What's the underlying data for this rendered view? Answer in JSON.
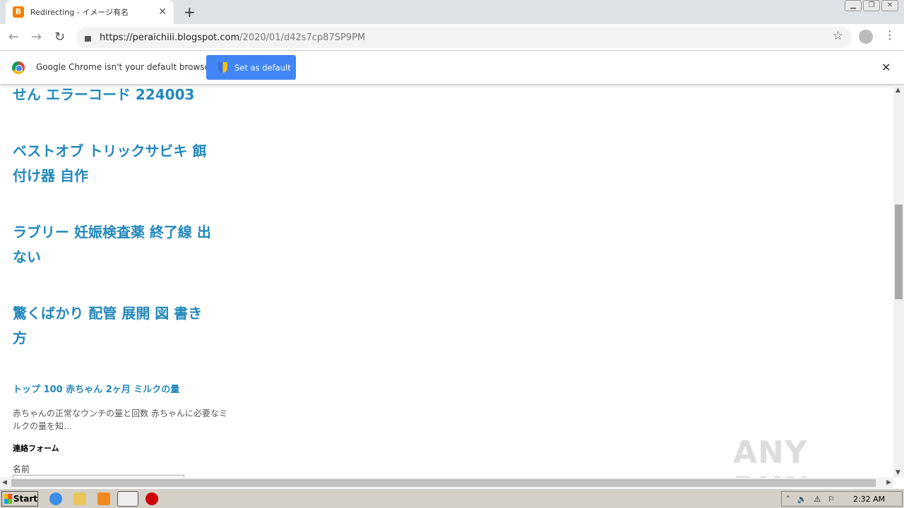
{
  "browser": {
    "tab_title": "Redirecting - イメージ有名",
    "tab_favicon": "blogger-icon",
    "url_host": "https://peraichiii.blogspot.com",
    "url_path": "/2020/01/d42s7cp87SP9PM"
  },
  "infobar": {
    "message": "Google Chrome isn't your default browser",
    "button": "Set as default"
  },
  "content": {
    "posts": [
      {
        "lines": [
          "せん エラーコード 224003"
        ]
      },
      {
        "lines": [
          "ベストオブ トリックサビキ 餌",
          "付け器 自作"
        ]
      },
      {
        "lines": [
          "ラブリー 妊娠検査薬 終了線 出",
          "ない"
        ]
      },
      {
        "lines": [
          "驚くばかり 配管 展開 図 書き",
          "方"
        ]
      }
    ],
    "popular_title": "トップ 100 赤ちゃん 2ヶ月 ミルクの量",
    "popular_snippet": "赤ちゃんの正常なウンチの量と回数 赤ちゃんに必要なミルクの量を知…",
    "form_heading": "連絡フォーム",
    "name_label": "名前",
    "watermark": "ANY RUN"
  },
  "scroll": {
    "vertical_position_percent": 32,
    "horizontal_visible_percent": 98
  },
  "taskbar": {
    "start": "Start",
    "clock": "2:32 AM"
  },
  "colors": {
    "link": "#2288bb",
    "button": "#4285f4"
  }
}
